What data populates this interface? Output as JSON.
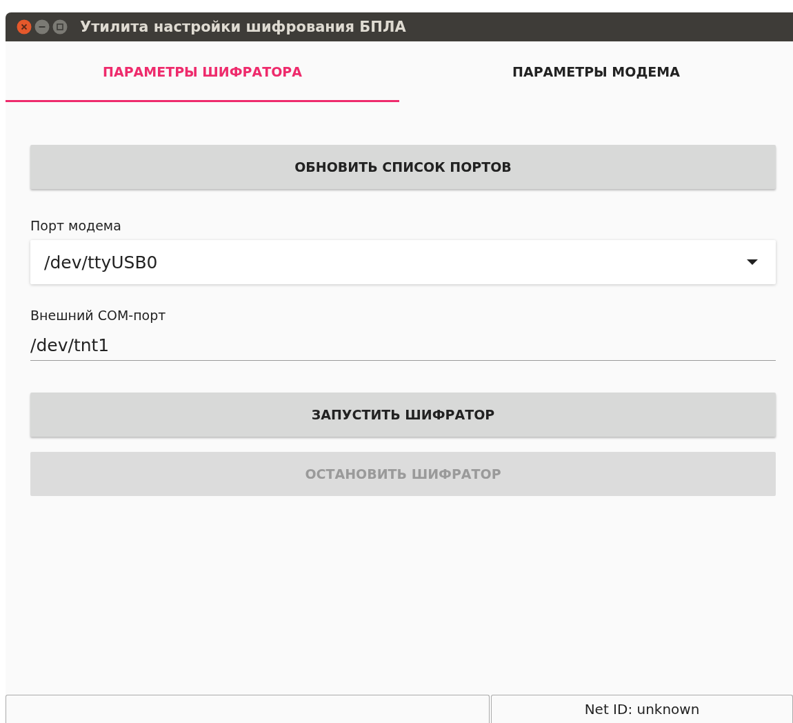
{
  "window": {
    "title": "Утилита настройки шифрования БПЛА"
  },
  "tabs": [
    {
      "label": "ПАРАМЕТРЫ ШИФРАТОРА",
      "selected": true
    },
    {
      "label": "ПАРАМЕТРЫ МОДЕМА",
      "selected": false
    }
  ],
  "form": [
    {
      "kind": "button",
      "label": "ОБНОВИТЬ СПИСОК ПОРТОВ",
      "disabled": false
    },
    {
      "kind": "dropdown",
      "label": "Порт модема",
      "value": "/dev/ttyUSB0"
    },
    {
      "kind": "text",
      "label": "Внешний COM-порт",
      "value": "/dev/tnt1"
    },
    {
      "kind": "button",
      "label": "ЗАПУСТИТЬ ШИФРАТОР",
      "disabled": false
    },
    {
      "kind": "button",
      "label": "ОСТАНОВИТЬ ШИФРАТОР",
      "disabled": true
    }
  ],
  "status_bar": [
    {
      "kind": "blank"
    },
    {
      "kind": "text",
      "text": "Net ID: unknown"
    }
  ]
}
